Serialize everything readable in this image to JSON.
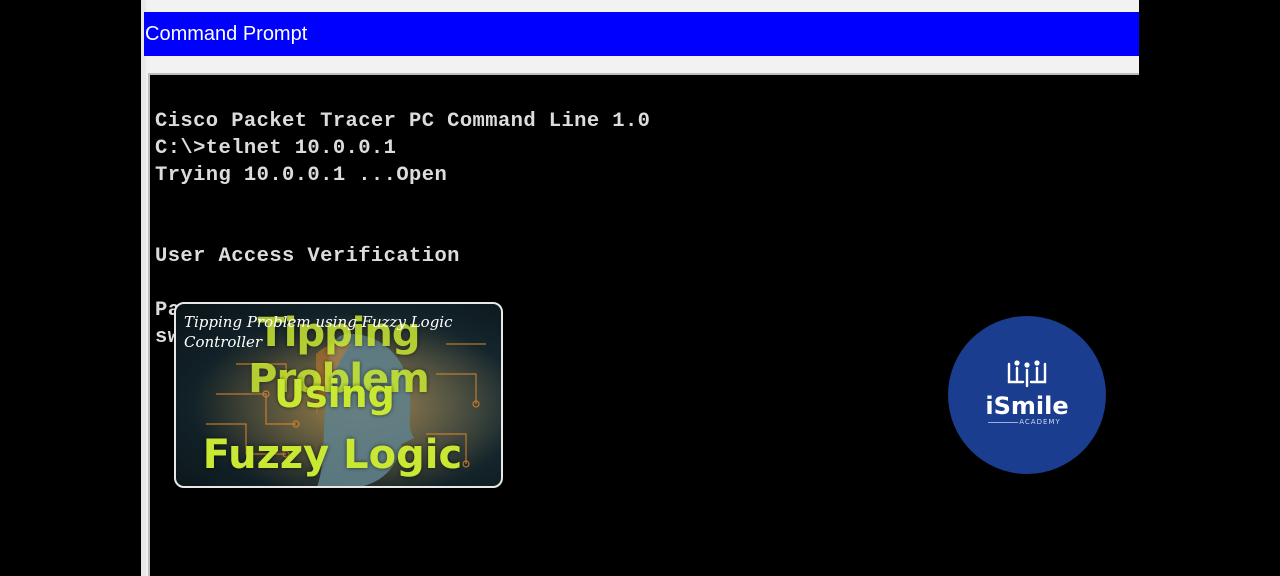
{
  "window": {
    "title": "Command Prompt"
  },
  "terminal": {
    "lines": [
      "Cisco Packet Tracer PC Command Line 1.0",
      "C:\\>telnet 10.0.0.1",
      "Trying 10.0.0.1 ...Open",
      "",
      "",
      "User Access Verification",
      "",
      "Pa",
      "sw"
    ]
  },
  "thumbnail": {
    "title": "Tipping Problem using Fuzzy Logic Controller",
    "overlay_line1": "Tipping Problem",
    "overlay_line2": "Using",
    "overlay_line3": "Fuzzy Logic"
  },
  "logo": {
    "brand": "iSmile",
    "sub": "ACADEMY",
    "icon": "book-people-icon"
  },
  "colors": {
    "titlebar": "#0000ff",
    "terminal_bg": "#000000",
    "terminal_text": "#dcdcdc",
    "accent": "#c9e832",
    "logo_bg": "#1a3d8f"
  }
}
